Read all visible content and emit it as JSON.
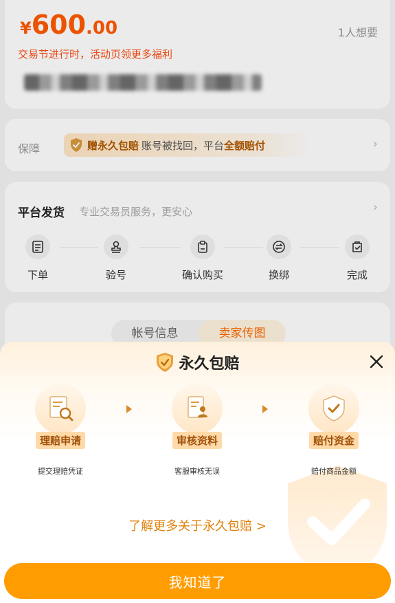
{
  "listing": {
    "price_symbol": "¥",
    "price_int": "600",
    "price_dec": ".00",
    "want_count": "1人想要",
    "promo_text": "交易节进行时，活动页领更多福利"
  },
  "guarantee": {
    "label": "保障",
    "pill_strong": "赠永久包赔",
    "pill_text": "账号被找回，平台",
    "pill_strong2": "全额赔付"
  },
  "shipping": {
    "title": "平台发货",
    "subtitle": "专业交易员服务，更安心",
    "steps": [
      {
        "label": "下单",
        "icon": "order-icon"
      },
      {
        "label": "验号",
        "icon": "stamp-icon"
      },
      {
        "label": "确认购买",
        "icon": "clipboard-icon"
      },
      {
        "label": "换绑",
        "icon": "swap-icon"
      },
      {
        "label": "完成",
        "icon": "check-bag-icon"
      }
    ]
  },
  "tabs": [
    {
      "label": "帐号信息",
      "active": false
    },
    {
      "label": "卖家传图",
      "active": true
    }
  ],
  "sheet": {
    "title": "永久包赔",
    "steps": [
      {
        "badge": "理赔申请",
        "desc": "提交理赔凭证",
        "icon": "document-search-icon"
      },
      {
        "badge": "审核资料",
        "desc": "客服审核无误",
        "icon": "document-review-icon"
      },
      {
        "badge": "赔付资金",
        "desc": "赔付商品金额",
        "icon": "shield-check-icon"
      }
    ],
    "learn_more": "了解更多关于永久包赔 >",
    "confirm_button": "我知道了"
  },
  "colors": {
    "accent": "#ff9c00",
    "price": "#ff5b00",
    "badge_bg": "#ffd9a8",
    "badge_text": "#a0520a"
  }
}
